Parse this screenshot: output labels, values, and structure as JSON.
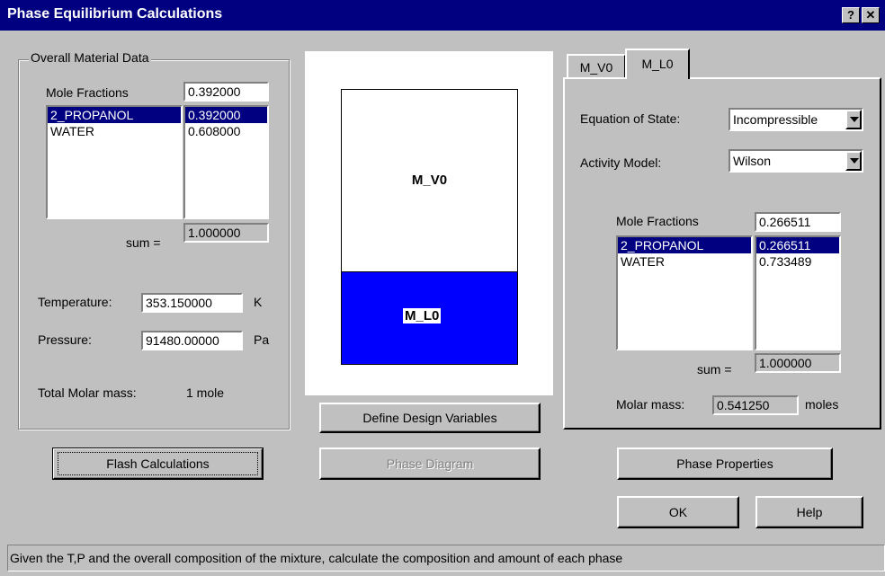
{
  "window": {
    "title": "Phase Equilibrium Calculations",
    "help_btn": "?",
    "close_btn": "✕"
  },
  "overall": {
    "group_label": "Overall Material Data",
    "mole_fractions_label": "Mole Fractions",
    "mole_fraction_value": "0.392000",
    "components": [
      "2_PROPANOL",
      "WATER"
    ],
    "fractions": [
      "0.392000",
      "0.608000"
    ],
    "sum_label": "sum =",
    "sum_value": "1.000000",
    "temperature_label": "Temperature:",
    "temperature_value": "353.150000",
    "temperature_unit": "K",
    "pressure_label": "Pressure:",
    "pressure_value": "91480.00000",
    "pressure_unit": "Pa",
    "total_molar_label": "Total Molar mass:",
    "total_molar_value": "1 mole"
  },
  "diagram": {
    "vapor_label": "M_V0",
    "liquid_label": "M_L0",
    "liquid_color": "#0000ff"
  },
  "tabs": {
    "items": [
      "M_V0",
      "M_L0"
    ],
    "active": "M_L0"
  },
  "phase": {
    "eos_label": "Equation of State:",
    "eos_value": "Incompressible",
    "activity_label": "Activity Model:",
    "activity_value": "Wilson",
    "mole_fractions_label": "Mole Fractions",
    "mole_fraction_value": "0.266511",
    "components": [
      "2_PROPANOL",
      "WATER"
    ],
    "fractions": [
      "0.266511",
      "0.733489"
    ],
    "sum_label": "sum =",
    "sum_value": "1.000000",
    "molar_label": "Molar mass:",
    "molar_value": "0.541250",
    "molar_unit": "moles"
  },
  "buttons": {
    "define_design": "Define Design Variables",
    "flash": "Flash Calculations",
    "phase_diagram": "Phase Diagram",
    "phase_properties": "Phase Properties",
    "ok": "OK",
    "help": "Help"
  },
  "status": {
    "text": "Given the T,P and the overall composition of the mixture, calculate the composition and amount of each phase"
  }
}
